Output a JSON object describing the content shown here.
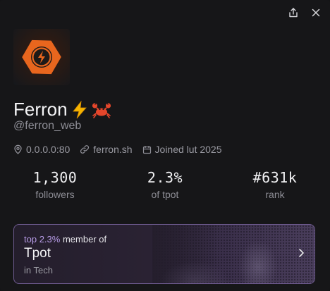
{
  "profile": {
    "name": "Ferron",
    "emojis": [
      "⚡",
      "🦀"
    ],
    "handle": "@ferron_web",
    "location": "0.0.0.0:80",
    "website": "ferron.sh",
    "joined": "Joined lut 2025"
  },
  "stats": [
    {
      "value": "1,300",
      "label": "followers"
    },
    {
      "value": "2.3%",
      "label": "of tpot"
    },
    {
      "value": "#631k",
      "label": "rank"
    }
  ],
  "membership": {
    "top_prefix": "top",
    "top_pct": "2.3%",
    "top_suffix": "member of",
    "title": "Tpot",
    "subtitle": "in Tech"
  },
  "icons": {
    "share": "share-icon",
    "close": "close-icon",
    "location": "location-pin-icon",
    "link": "link-icon",
    "calendar": "calendar-icon",
    "chevron": "chevron-right-icon"
  },
  "colors": {
    "accent": "#b79be6",
    "avatar_orange": "#e8661e",
    "membership_border": "#6d5a8e"
  }
}
